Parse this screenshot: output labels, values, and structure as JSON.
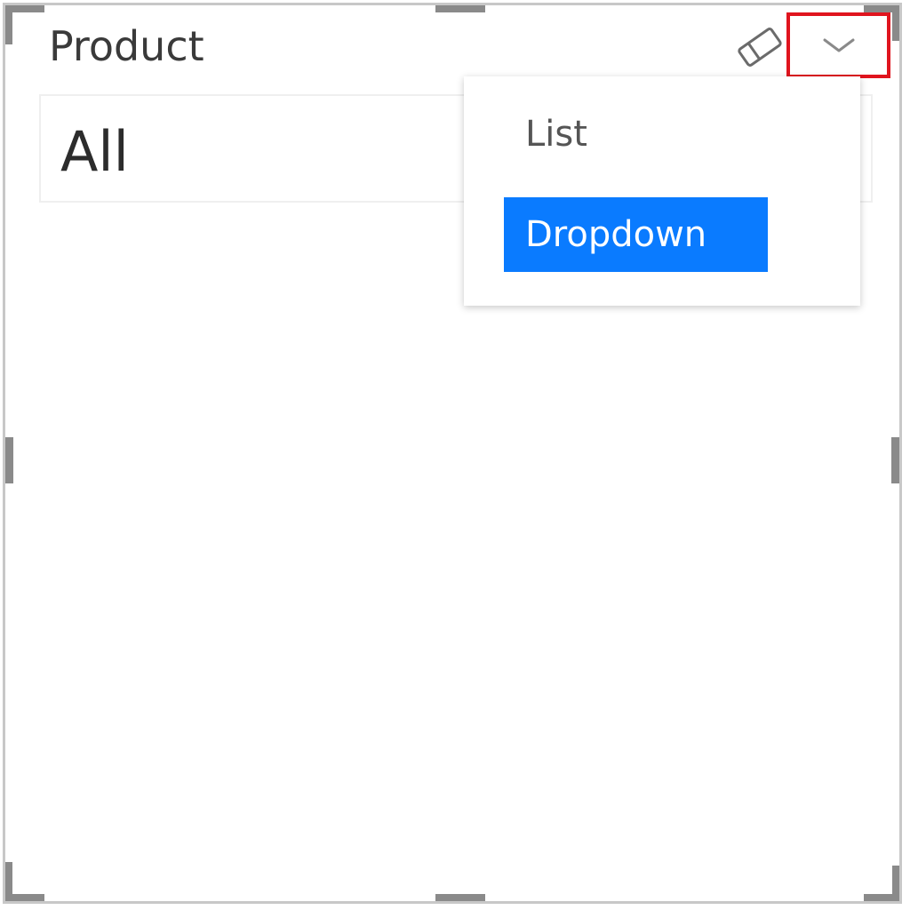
{
  "slicer": {
    "title": "Product",
    "selected_value": "All"
  },
  "menu": {
    "items": [
      {
        "label": "List",
        "selected": false
      },
      {
        "label": "Dropdown",
        "selected": true
      }
    ]
  },
  "icons": {
    "clear": "eraser-icon",
    "toggle": "chevron-down-icon"
  },
  "colors": {
    "highlight_border": "#e0141e",
    "selected_item_bg": "#0a7bff",
    "selected_item_text": "#ffffff"
  }
}
